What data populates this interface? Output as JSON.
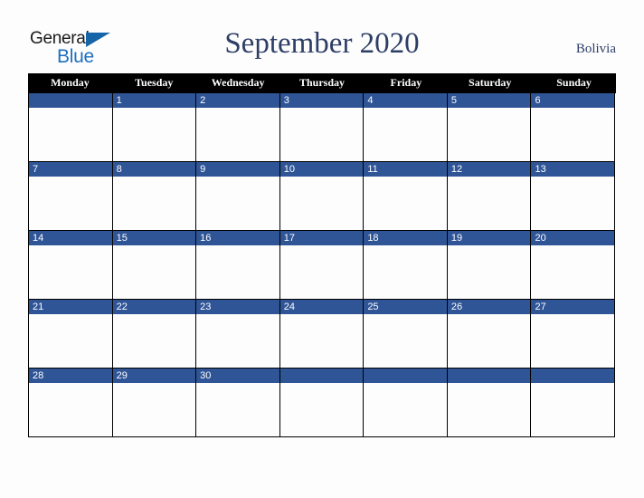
{
  "logo": {
    "word_one": "General",
    "word_two": "Blue",
    "triangle_icon": "triangle-icon",
    "color_dark": "#1a1a1a",
    "color_blue": "#1d6fc0"
  },
  "header": {
    "title": "September 2020",
    "month": "September",
    "year": "2020",
    "country": "Bolivia",
    "title_color": "#2d3e66"
  },
  "calendar": {
    "accent_color": "#2f5597",
    "header_bg": "#000000",
    "cell_bg": "#fdfdfd",
    "border_color": "#000000",
    "week_start": "Monday",
    "day_names": [
      "Monday",
      "Tuesday",
      "Wednesday",
      "Thursday",
      "Friday",
      "Saturday",
      "Sunday"
    ],
    "weeks": [
      [
        "",
        "1",
        "2",
        "3",
        "4",
        "5",
        "6"
      ],
      [
        "7",
        "8",
        "9",
        "10",
        "11",
        "12",
        "13"
      ],
      [
        "14",
        "15",
        "16",
        "17",
        "18",
        "19",
        "20"
      ],
      [
        "21",
        "22",
        "23",
        "24",
        "25",
        "26",
        "27"
      ],
      [
        "28",
        "29",
        "30",
        "",
        "",
        "",
        ""
      ]
    ]
  }
}
